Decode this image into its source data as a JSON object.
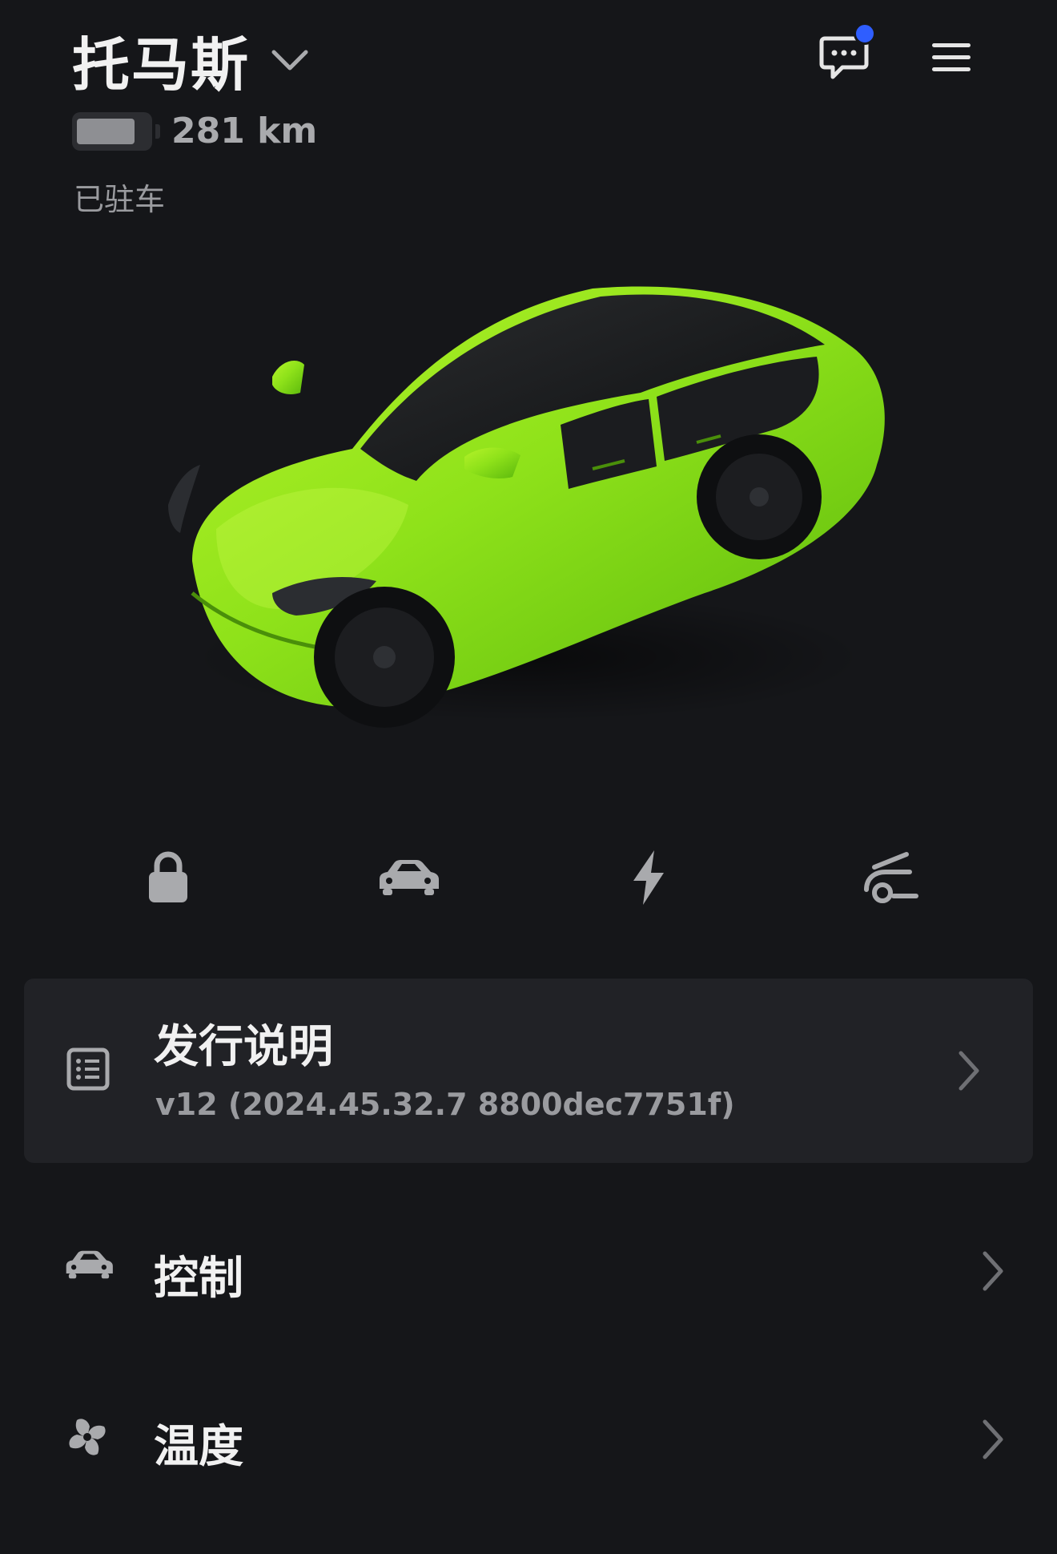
{
  "header": {
    "vehicle_name": "托马斯",
    "range": "281 km",
    "status": "已驻车",
    "battery_level": 0.82
  },
  "icons": {
    "messages": "chat-bubble-icon",
    "menu": "hamburger-menu-icon",
    "lock": "lock-icon",
    "climate_car": "car-fan-icon",
    "charging": "lightning-bolt-icon",
    "frunk": "car-open-frunk-icon",
    "release_notes": "list-document-icon",
    "controls": "car-icon",
    "climate": "fan-icon"
  },
  "colors": {
    "background": "#151619",
    "card": "#212226",
    "accent_dot": "#2f5eff",
    "car_paint": "#8fe21a"
  },
  "release_notes": {
    "title": "发行说明",
    "version": "v12 (2024.45.32.7 8800dec7751f)"
  },
  "menu": [
    {
      "label": "控制"
    },
    {
      "label": "温度"
    }
  ]
}
